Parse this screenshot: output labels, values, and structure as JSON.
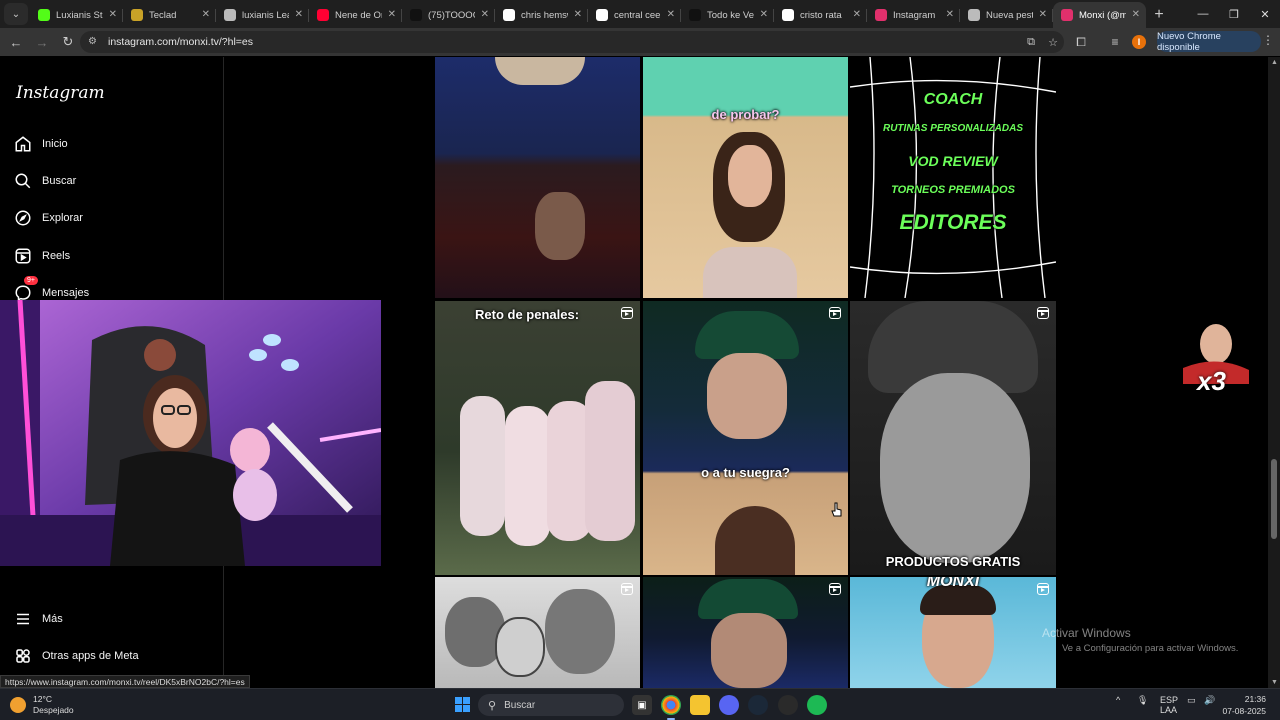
{
  "browser": {
    "tabs": [
      {
        "title": "Luxianis Stre",
        "favicon": "kick",
        "color": "#53fc18",
        "active": false
      },
      {
        "title": "Teclad",
        "favicon": "mail",
        "color": "#c9a227",
        "active": false
      },
      {
        "title": "luxianis Leag",
        "favicon": "league",
        "color": "#bbbbbb",
        "active": false
      },
      {
        "title": "Nene de Orc",
        "favicon": "youtube",
        "color": "#ff0033",
        "active": false
      },
      {
        "title": "(75)TOOOO",
        "favicon": "tiktok",
        "color": "#111111",
        "active": false
      },
      {
        "title": "chris hemsw",
        "favicon": "google",
        "color": "#ffffff",
        "active": false
      },
      {
        "title": "central cee",
        "favicon": "google",
        "color": "#ffffff",
        "active": false
      },
      {
        "title": "Todo ke Ver",
        "favicon": "tiktok",
        "color": "#111111",
        "active": false
      },
      {
        "title": "cristo rata",
        "favicon": "google",
        "color": "#ffffff",
        "active": false
      },
      {
        "title": "Instagram",
        "favicon": "instagram",
        "color": "#e1306c",
        "active": false
      },
      {
        "title": "Nueva pesta",
        "favicon": "chrome",
        "color": "#bbbbbb",
        "active": false
      },
      {
        "title": "Monxi (@mo",
        "favicon": "instagram",
        "color": "#e1306c",
        "active": true
      }
    ],
    "url": "instagram.com/monxi.tv/?hl=es",
    "update_label": "Nuevo Chrome disponible",
    "profile_initial": "I",
    "status_url": "https://www.instagram.com/monxi.tv/reel/DK5xBrNO2bC/?hl=es"
  },
  "instagram": {
    "logo": "Instagram",
    "nav": [
      {
        "label": "Inicio",
        "icon": "home-icon"
      },
      {
        "label": "Buscar",
        "icon": "search-icon"
      },
      {
        "label": "Explorar",
        "icon": "compass-icon"
      },
      {
        "label": "Reels",
        "icon": "reels-icon"
      },
      {
        "label": "Mensajes",
        "icon": "messenger-icon",
        "badge": "9+"
      },
      {
        "label": "Más",
        "icon": "menu-icon"
      },
      {
        "label": "Otras apps de Meta",
        "icon": "meta-apps-icon"
      }
    ],
    "tiles": [
      {
        "caption": "",
        "reel": false
      },
      {
        "caption": "de probar?",
        "reel": false
      },
      {
        "caption": "",
        "reel": false,
        "lines": [
          "COACH",
          "RUTINAS PERSONALIZADAS",
          "VOD REVIEW",
          "TORNEOS PREMIADOS",
          "EDITORES"
        ]
      },
      {
        "caption": "Reto de penales:",
        "reel": true
      },
      {
        "caption": "o a tu suegra?",
        "reel": true
      },
      {
        "caption": "PRODUCTOS GRATIS",
        "reel": true
      },
      {
        "caption": "",
        "reel": true
      },
      {
        "caption": "",
        "reel": true
      },
      {
        "caption": "MONXI",
        "reel": true
      }
    ]
  },
  "overlay": {
    "sticker_text": "x3"
  },
  "windows": {
    "watermark_title": "Activar Windows",
    "watermark_sub": "Ve a Configuración para activar Windows.",
    "weather_temp": "12°C",
    "weather_desc": "Despejado",
    "search_placeholder": "Buscar",
    "lang_top": "ESP",
    "lang_bottom": "LAA",
    "time": "21:36",
    "date": "07-08-2025"
  }
}
